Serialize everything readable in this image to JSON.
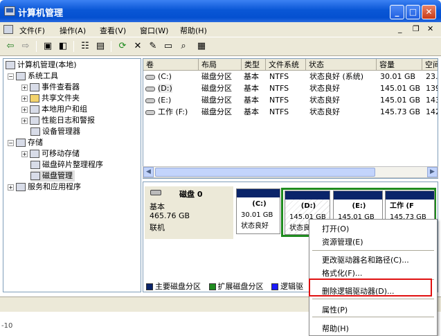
{
  "window": {
    "title": "计算机管理"
  },
  "menu": [
    "文件(F)",
    "操作(A)",
    "查看(V)",
    "窗口(W)",
    "帮助(H)"
  ],
  "tree": {
    "root": "计算机管理(本地)",
    "system_tools": "系统工具",
    "children_system": [
      "事件查看器",
      "共享文件夹",
      "本地用户和组",
      "性能日志和警报",
      "设备管理器"
    ],
    "storage": "存储",
    "children_storage": [
      "可移动存储",
      "磁盘碎片整理程序",
      "磁盘管理"
    ],
    "services": "服务和应用程序"
  },
  "columns": [
    "卷",
    "布局",
    "类型",
    "文件系统",
    "状态",
    "容量",
    "空间"
  ],
  "volumes": [
    {
      "vol": "(C:)",
      "layout": "磁盘分区",
      "type": "基本",
      "fs": "NTFS",
      "status": "状态良好 (系统)",
      "cap": "30.01 GB",
      "free": "23."
    },
    {
      "vol": "(D:)",
      "layout": "磁盘分区",
      "type": "基本",
      "fs": "NTFS",
      "status": "状态良好",
      "cap": "145.01 GB",
      "free": "139"
    },
    {
      "vol": "(E:)",
      "layout": "磁盘分区",
      "type": "基本",
      "fs": "NTFS",
      "status": "状态良好",
      "cap": "145.01 GB",
      "free": "143"
    },
    {
      "vol": "工作 (F:)",
      "layout": "磁盘分区",
      "type": "基本",
      "fs": "NTFS",
      "status": "状态良好",
      "cap": "145.73 GB",
      "free": "142"
    }
  ],
  "disk": {
    "name": "磁盘 0",
    "type": "基本",
    "size": "465.76 GB",
    "state": "联机"
  },
  "partitions": [
    {
      "name": "(C:)",
      "size": "30.01 GB",
      "status": "状态良好"
    },
    {
      "name": "(D:)",
      "size": "145.01 GB",
      "status": "状态良"
    },
    {
      "name": "(E:)",
      "size": "145.01 GB",
      "status": ""
    },
    {
      "name": "工作 (F",
      "size": "145.73 GB",
      "status": ""
    }
  ],
  "legend": [
    "主要磁盘分区",
    "扩展磁盘分区",
    "逻辑驱"
  ],
  "status_left": "-10",
  "context_menu": [
    "打开(O)",
    "资源管理(E)",
    "更改驱动器名和路径(C)...",
    "格式化(F)...",
    "删除逻辑驱动器(D)...",
    "属性(P)",
    "帮助(H)"
  ],
  "colors": {
    "primary": "#0a246a",
    "extended": "#1f8c1f",
    "logical": "#1a1aff",
    "highlight": "#e01010"
  }
}
